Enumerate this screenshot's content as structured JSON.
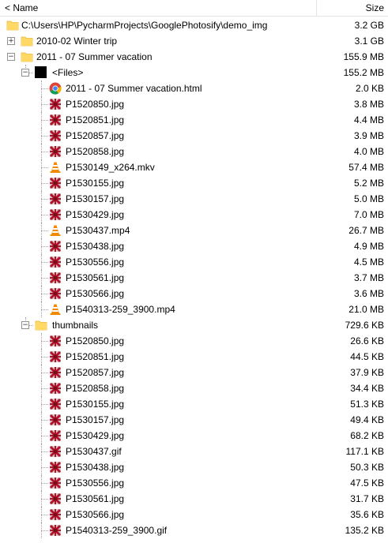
{
  "header": {
    "name_label": "< Name",
    "size_label": "Size"
  },
  "tree": [
    {
      "label": "C:\\Users\\HP\\PycharmProjects\\GooglePhotosify\\demo_img",
      "size": "3.2 GB",
      "icon": "folder-icon",
      "depth": 0,
      "expander": ""
    },
    {
      "label": "2010-02 Winter trip",
      "size": "3.1 GB",
      "icon": "folder-icon",
      "depth": 1,
      "expander": "+"
    },
    {
      "label": "2011 - 07 Summer vacation",
      "size": "155.9 MB",
      "icon": "folder-icon",
      "depth": 1,
      "expander": "-"
    },
    {
      "label": "<Files>",
      "size": "155.2 MB",
      "icon": "files-block-icon",
      "depth": 2,
      "expander": "-"
    },
    {
      "label": "2011 - 07 Summer vacation.html",
      "size": "2.0 KB",
      "icon": "chrome-icon",
      "depth": 3,
      "expander": ""
    },
    {
      "label": "P1520850.jpg",
      "size": "3.8 MB",
      "icon": "image-file-icon",
      "depth": 3,
      "expander": ""
    },
    {
      "label": "P1520851.jpg",
      "size": "4.4 MB",
      "icon": "image-file-icon",
      "depth": 3,
      "expander": ""
    },
    {
      "label": "P1520857.jpg",
      "size": "3.9 MB",
      "icon": "image-file-icon",
      "depth": 3,
      "expander": ""
    },
    {
      "label": "P1520858.jpg",
      "size": "4.0 MB",
      "icon": "image-file-icon",
      "depth": 3,
      "expander": ""
    },
    {
      "label": "P1530149_x264.mkv",
      "size": "57.4 MB",
      "icon": "vlc-cone-icon",
      "depth": 3,
      "expander": ""
    },
    {
      "label": "P1530155.jpg",
      "size": "5.2 MB",
      "icon": "image-file-icon",
      "depth": 3,
      "expander": ""
    },
    {
      "label": "P1530157.jpg",
      "size": "5.0 MB",
      "icon": "image-file-icon",
      "depth": 3,
      "expander": ""
    },
    {
      "label": "P1530429.jpg",
      "size": "7.0 MB",
      "icon": "image-file-icon",
      "depth": 3,
      "expander": ""
    },
    {
      "label": "P1530437.mp4",
      "size": "26.7 MB",
      "icon": "vlc-cone-icon",
      "depth": 3,
      "expander": ""
    },
    {
      "label": "P1530438.jpg",
      "size": "4.9 MB",
      "icon": "image-file-icon",
      "depth": 3,
      "expander": ""
    },
    {
      "label": "P1530556.jpg",
      "size": "4.5 MB",
      "icon": "image-file-icon",
      "depth": 3,
      "expander": ""
    },
    {
      "label": "P1530561.jpg",
      "size": "3.7 MB",
      "icon": "image-file-icon",
      "depth": 3,
      "expander": ""
    },
    {
      "label": "P1530566.jpg",
      "size": "3.6 MB",
      "icon": "image-file-icon",
      "depth": 3,
      "expander": ""
    },
    {
      "label": "P1540313-259_3900.mp4",
      "size": "21.0 MB",
      "icon": "vlc-cone-icon",
      "depth": 3,
      "expander": ""
    },
    {
      "label": "thumbnails",
      "size": "729.6 KB",
      "icon": "folder-icon",
      "depth": 2,
      "expander": "-"
    },
    {
      "label": "P1520850.jpg",
      "size": "26.6 KB",
      "icon": "image-file-icon",
      "depth": 3,
      "expander": ""
    },
    {
      "label": "P1520851.jpg",
      "size": "44.5 KB",
      "icon": "image-file-icon",
      "depth": 3,
      "expander": ""
    },
    {
      "label": "P1520857.jpg",
      "size": "37.9 KB",
      "icon": "image-file-icon",
      "depth": 3,
      "expander": ""
    },
    {
      "label": "P1520858.jpg",
      "size": "34.4 KB",
      "icon": "image-file-icon",
      "depth": 3,
      "expander": ""
    },
    {
      "label": "P1530155.jpg",
      "size": "51.3 KB",
      "icon": "image-file-icon",
      "depth": 3,
      "expander": ""
    },
    {
      "label": "P1530157.jpg",
      "size": "49.4 KB",
      "icon": "image-file-icon",
      "depth": 3,
      "expander": ""
    },
    {
      "label": "P1530429.jpg",
      "size": "68.2 KB",
      "icon": "image-file-icon",
      "depth": 3,
      "expander": ""
    },
    {
      "label": "P1530437.gif",
      "size": "117.1 KB",
      "icon": "image-file-icon",
      "depth": 3,
      "expander": ""
    },
    {
      "label": "P1530438.jpg",
      "size": "50.3 KB",
      "icon": "image-file-icon",
      "depth": 3,
      "expander": ""
    },
    {
      "label": "P1530556.jpg",
      "size": "47.5 KB",
      "icon": "image-file-icon",
      "depth": 3,
      "expander": ""
    },
    {
      "label": "P1530561.jpg",
      "size": "31.7 KB",
      "icon": "image-file-icon",
      "depth": 3,
      "expander": ""
    },
    {
      "label": "P1530566.jpg",
      "size": "35.6 KB",
      "icon": "image-file-icon",
      "depth": 3,
      "expander": ""
    },
    {
      "label": "P1540313-259_3900.gif",
      "size": "135.2 KB",
      "icon": "image-file-icon",
      "depth": 3,
      "expander": ""
    }
  ],
  "colors": {
    "folder": "#ffd866",
    "folder_dark": "#e8b93a",
    "image": "#b0122a",
    "vlc": "#f08a00"
  }
}
